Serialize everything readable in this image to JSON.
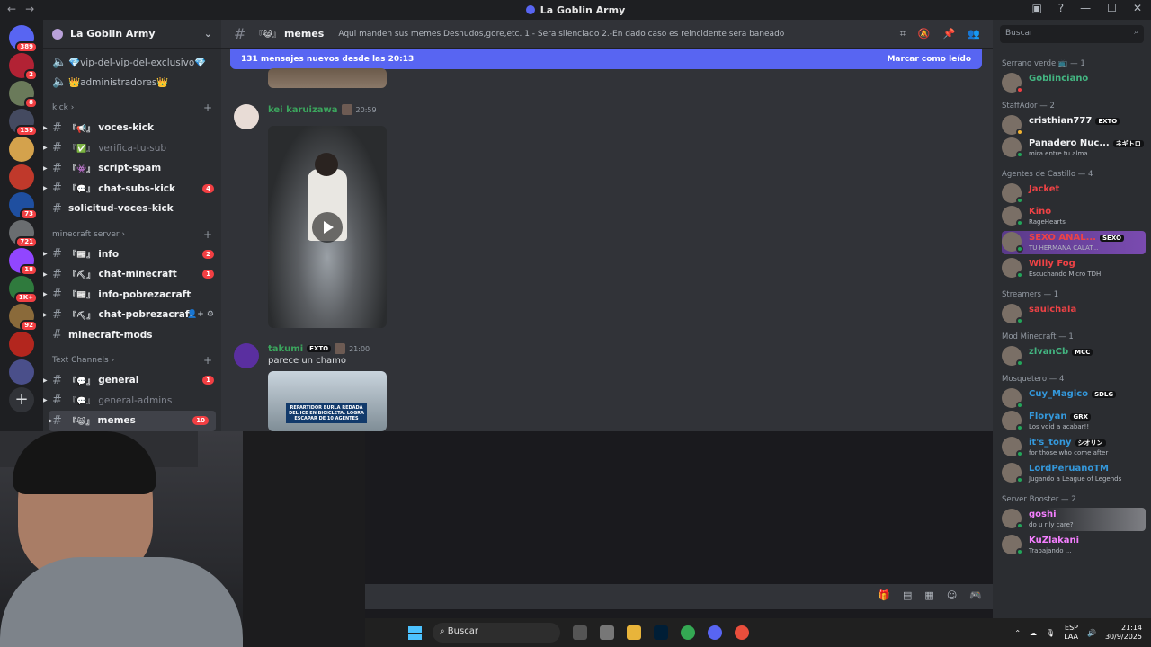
{
  "window": {
    "title": "La Goblin Army"
  },
  "guilds": [
    {
      "badge": "389",
      "color": "#5865f2"
    },
    {
      "badge": "2",
      "color": "#b22234"
    },
    {
      "badge": "8",
      "color": "#6a7a5a"
    },
    {
      "badge": "139",
      "color": "#444a60"
    },
    {
      "badge": "",
      "color": "#d4a24c"
    },
    {
      "badge": "",
      "color": "#c0392b"
    },
    {
      "badge": "73",
      "color": "#1f4fa0"
    },
    {
      "badge": "721",
      "color": "#6a6d70"
    },
    {
      "badge": "18",
      "color": "#9146ff"
    },
    {
      "badge": "1K+",
      "color": "#2f7a3d"
    },
    {
      "badge": "92",
      "color": "#8a6a3a"
    },
    {
      "badge": "",
      "color": "#b3261e"
    },
    {
      "badge": "",
      "color": "#4a4f8a"
    }
  ],
  "server": {
    "name": "La Goblin Army"
  },
  "sidebar": {
    "top_channels": [
      {
        "name": "💎vip-del-vip-del-exclusivo💎"
      },
      {
        "name": "👑administradores👑"
      }
    ],
    "categories": [
      {
        "name": "kick",
        "channels": [
          {
            "tag": "『📢』",
            "name": "voces-kick",
            "unread": "",
            "muted": false
          },
          {
            "tag": "『✅』",
            "name": "verifica-tu-sub",
            "unread": "",
            "muted": true
          },
          {
            "tag": "『👾』",
            "name": "script-spam",
            "unread": "",
            "muted": false
          },
          {
            "tag": "『💬』",
            "name": "chat-subs-kick",
            "unread": "4",
            "muted": false
          },
          {
            "tag": "",
            "name": "solicitud-voces-kick",
            "unread": "",
            "muted": false
          }
        ]
      },
      {
        "name": "minecraft server",
        "channels": [
          {
            "tag": "『📰』",
            "name": "info",
            "unread": "2",
            "muted": false
          },
          {
            "tag": "『⛏』",
            "name": "chat-minecraft",
            "unread": "1",
            "muted": false
          },
          {
            "tag": "『📰』",
            "name": "info-pobrezacraft",
            "unread": "",
            "muted": false
          },
          {
            "tag": "『⛏』",
            "name": "chat-pobrezacraft",
            "unread": "",
            "muted": false
          },
          {
            "tag": "",
            "name": "minecraft-mods",
            "unread": "",
            "muted": false
          }
        ]
      },
      {
        "name": "Text Channels",
        "channels": [
          {
            "tag": "『💬』",
            "name": "general",
            "unread": "1",
            "muted": false
          },
          {
            "tag": "『💬』",
            "name": "general-admins",
            "unread": "",
            "muted": true
          },
          {
            "tag": "『😹』",
            "name": "memes",
            "unread": "10",
            "muted": false
          }
        ]
      }
    ]
  },
  "header": {
    "channel_tag": "『😹』",
    "channel_name": "memes",
    "topic": "Aqui manden sus memes.Desnudos,gore,etc. 1.- Sera silenciado 2.-En dado caso es reincidente sera baneado"
  },
  "newbar": {
    "text": "131 mensajes nuevos desde las 20:13",
    "mark": "Marcar como leído"
  },
  "messages": [
    {
      "user": "kei karuizawa",
      "time": "20:59",
      "color": "#3ba55d",
      "text": ""
    },
    {
      "user": "takumi",
      "tag": "EXTO",
      "time": "21:00",
      "color": "#3ba55d",
      "text": "parece un chamo",
      "news": "REPARTIDOR BURLA REDADA DEL ICE EN BICICLETA: LOGRA ESCAPAR DE 10 AGENTES"
    }
  ],
  "search": {
    "placeholder": "Buscar"
  },
  "members": {
    "groups": [
      {
        "label": "Serrano verde 📺 — 1",
        "members": [
          {
            "name": "Goblinciano",
            "tag": "",
            "sub": "",
            "color": "#43b581",
            "status": "#f23f43"
          }
        ]
      },
      {
        "label": "StaffAdor — 2",
        "members": [
          {
            "name": "cristhian777",
            "tag": "EXTO",
            "sub": "",
            "color": "#f2f3f5",
            "status": "#f0b232"
          },
          {
            "name": "Panadero Nuc...",
            "tag": "ネギトロ",
            "sub": "mira entre tu alma.",
            "color": "#f2f3f5",
            "status": "#23a55a"
          }
        ]
      },
      {
        "label": "Agentes de Castillo — 4",
        "members": [
          {
            "name": "Jacket",
            "tag": "",
            "sub": "",
            "color": "#ed4245",
            "status": "#23a55a"
          },
          {
            "name": "Kino",
            "tag": "",
            "sub": "RageHearts",
            "color": "#ed4245",
            "status": "#23a55a"
          },
          {
            "name": "SEXO ANAL...",
            "tag": "SEXO",
            "sub": "TU HERMANA CALAT...",
            "color": "#ed4245",
            "status": "#23a55a"
          },
          {
            "name": "Willy Fog",
            "tag": "",
            "sub": "Escuchando Micro TDH",
            "color": "#ed4245",
            "status": "#23a55a"
          }
        ]
      },
      {
        "label": "Streamers — 1",
        "members": [
          {
            "name": "saulchala",
            "tag": "",
            "sub": "",
            "color": "#ed4245",
            "status": "#23a55a"
          }
        ]
      },
      {
        "label": "Mod Minecraft — 1",
        "members": [
          {
            "name": "zlvanCb",
            "tag": "MCC",
            "sub": "",
            "color": "#43b581",
            "status": "#23a55a"
          }
        ]
      },
      {
        "label": "Mosquetero — 4",
        "members": [
          {
            "name": "Cuy_Magico",
            "tag": "SDLG",
            "sub": "",
            "color": "#3498db",
            "status": "#23a55a"
          },
          {
            "name": "Floryan",
            "tag": "GRX",
            "sub": "Los void a acabar!!",
            "color": "#3498db",
            "status": "#23a55a"
          },
          {
            "name": "it's_tony",
            "tag": "シオリン",
            "sub": "for those who come after",
            "color": "#3498db",
            "status": "#23a55a"
          },
          {
            "name": "LordPeruanoTM",
            "tag": "",
            "sub": "Jugando a League of Legends",
            "color": "#3498db",
            "status": "#23a55a"
          }
        ]
      },
      {
        "label": "Server Booster — 2",
        "members": [
          {
            "name": "goshi",
            "tag": "",
            "sub": "do u rlly care?",
            "color": "#f47fff",
            "status": "#23a55a"
          },
          {
            "name": "KuZlakani",
            "tag": "",
            "sub": "Trabajando ...",
            "color": "#f47fff",
            "status": "#23a55a"
          }
        ]
      }
    ]
  },
  "taskbar": {
    "search": "Buscar",
    "lang": "ESP",
    "region": "LAA",
    "time": "21:14",
    "date": "30/9/2025"
  }
}
